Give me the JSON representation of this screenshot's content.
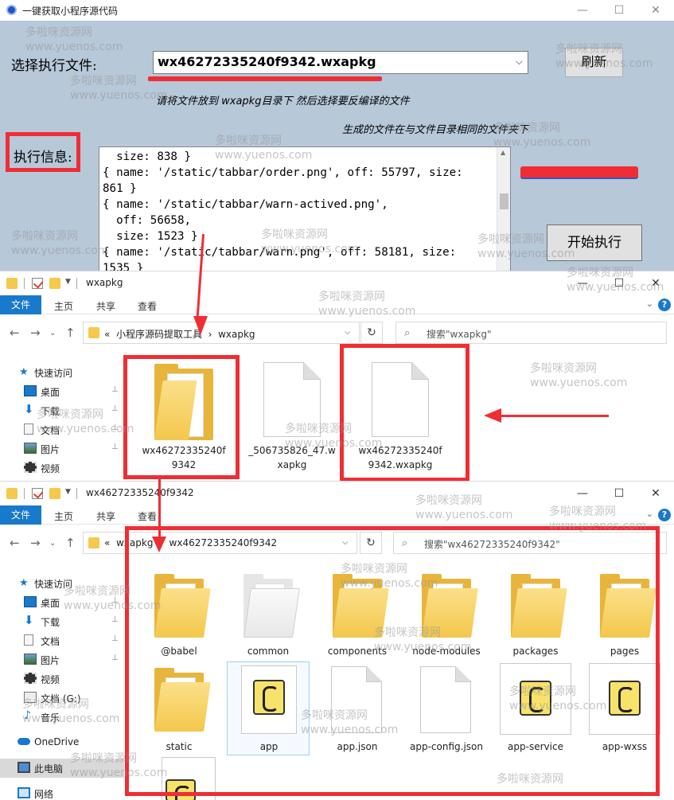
{
  "tool": {
    "title": "一键获取小程序源代码",
    "choose_label": "选择执行文件:",
    "selected_file": "wx46272335240f9342.wxapkg",
    "refresh_label": "刷新",
    "hint1": "请将文件放到 wxapkg目录下 然后选择要反编译的文件",
    "hint2": "生成的文件在与文件目录相同的文件夹下",
    "info_label": "执行信息:",
    "log_text": "  size: 838 }\n{ name: '/static/tabbar/order.png', off: 55797, size:\n861 }\n{ name: '/static/tabbar/warn-actived.png',\n  off: 56658,\n  size: 1523 }\n{ name: '/static/tabbar/warn.png', off: 58181, size:\n1535 }",
    "start_label": "开始执行",
    "window_controls": {
      "minimize": "—",
      "maximize": "☐",
      "close": "✕"
    }
  },
  "explorer1": {
    "title": "wxapkg",
    "ribbon": {
      "file": "文件",
      "home": "主页",
      "share": "共享",
      "view": "查看",
      "help": "?"
    },
    "address": {
      "prefix": "«",
      "crumb1": "小程序源码提取工具",
      "sep": "›",
      "crumb2": "wxapkg"
    },
    "search_placeholder": "搜索\"wxapkg\"",
    "sidebar": [
      {
        "label": "快速访问",
        "icon": "star-icon"
      },
      {
        "label": "桌面",
        "icon": "desktop-icon",
        "pin": "📌"
      },
      {
        "label": "下载",
        "icon": "download-icon",
        "pin": "📌"
      },
      {
        "label": "文档",
        "icon": "document-icon",
        "pin": "📌"
      },
      {
        "label": "图片",
        "icon": "pictures-icon",
        "pin": "📌"
      },
      {
        "label": "视频",
        "icon": "video-icon"
      }
    ],
    "files": [
      {
        "label": "wx46272335240f9342",
        "type": "folder"
      },
      {
        "label": "_506735826_47.wxapkg",
        "type": "file"
      },
      {
        "label": "wx46272335240f9342.wxapkg",
        "type": "file"
      }
    ]
  },
  "explorer2": {
    "title": "wx46272335240f9342",
    "ribbon": {
      "file": "文件",
      "home": "主页",
      "share": "共享",
      "view": "查看",
      "help": "?"
    },
    "address": {
      "prefix": "«",
      "crumb1": "wxapkg",
      "sep": "›",
      "crumb2": "wx46272335240f9342"
    },
    "search_placeholder": "搜索\"wx46272335240f9342\"",
    "sidebar": [
      {
        "label": "快速访问",
        "icon": "star-icon"
      },
      {
        "label": "桌面",
        "icon": "desktop-icon",
        "pin": "📌"
      },
      {
        "label": "下载",
        "icon": "download-icon",
        "pin": "📌"
      },
      {
        "label": "文档",
        "icon": "document-icon",
        "pin": "📌"
      },
      {
        "label": "图片",
        "icon": "pictures-icon",
        "pin": "📌"
      },
      {
        "label": "视频",
        "icon": "video-icon"
      },
      {
        "label": "文档 (G:)",
        "icon": "drive-icon"
      },
      {
        "label": "音乐",
        "icon": "music-icon"
      },
      {
        "label": "OneDrive",
        "icon": "cloud-icon"
      },
      {
        "label": "此电脑",
        "icon": "computer-icon"
      },
      {
        "label": "网络",
        "icon": "network-icon"
      }
    ],
    "files": [
      {
        "label": "@babel",
        "type": "folder"
      },
      {
        "label": "common",
        "type": "folder"
      },
      {
        "label": "components",
        "type": "folder"
      },
      {
        "label": "node-modules",
        "type": "folder"
      },
      {
        "label": "packages",
        "type": "folder"
      },
      {
        "label": "pages",
        "type": "folder"
      },
      {
        "label": "static",
        "type": "folder"
      },
      {
        "label": "app",
        "type": "script"
      },
      {
        "label": "app.json",
        "type": "file"
      },
      {
        "label": "app-config.json",
        "type": "file"
      },
      {
        "label": "app-service",
        "type": "script"
      },
      {
        "label": "app-wxss",
        "type": "script"
      }
    ]
  },
  "watermark": {
    "name": "多啦咪资源网",
    "url": "www.yuenos.com"
  },
  "colors": {
    "highlight_red": "#ee2e34",
    "ribbon_blue": "#1979ca",
    "tool_bg": "#b7c8d9",
    "folder_yellow": "#f3c74c"
  }
}
